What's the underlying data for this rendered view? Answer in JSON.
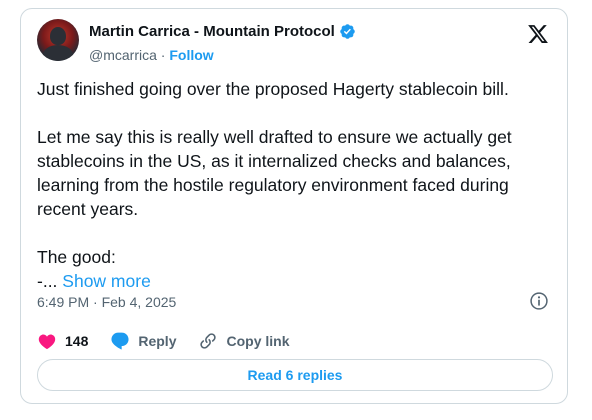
{
  "author": {
    "display_name": "Martin Carrica - Mountain Protocol",
    "handle": "@mcarrica",
    "separator": "·",
    "follow_label": "Follow"
  },
  "tweet": {
    "paragraphs": [
      "Just finished going over the proposed Hagerty stablecoin bill.",
      "Let me say this is really well drafted to ensure we actually get stablecoins in the US, as it internalized checks and balances, learning from the hostile regulatory environment faced during recent years.",
      "The good:"
    ],
    "truncated_line": "-...",
    "show_more_label": "Show more",
    "timestamp": "6:49 PM · Feb 4, 2025"
  },
  "actions": {
    "like_count": "148",
    "reply_label": "Reply",
    "copy_link_label": "Copy link"
  },
  "read_replies_label": "Read 6 replies",
  "colors": {
    "accent": "#1d9bf0",
    "like": "#f91880",
    "secondary_text": "#536471",
    "border": "#cfd9de"
  },
  "icons": [
    "x-logo-icon",
    "verified-badge-icon",
    "info-icon",
    "heart-icon",
    "reply-bubble-icon",
    "link-icon"
  ]
}
